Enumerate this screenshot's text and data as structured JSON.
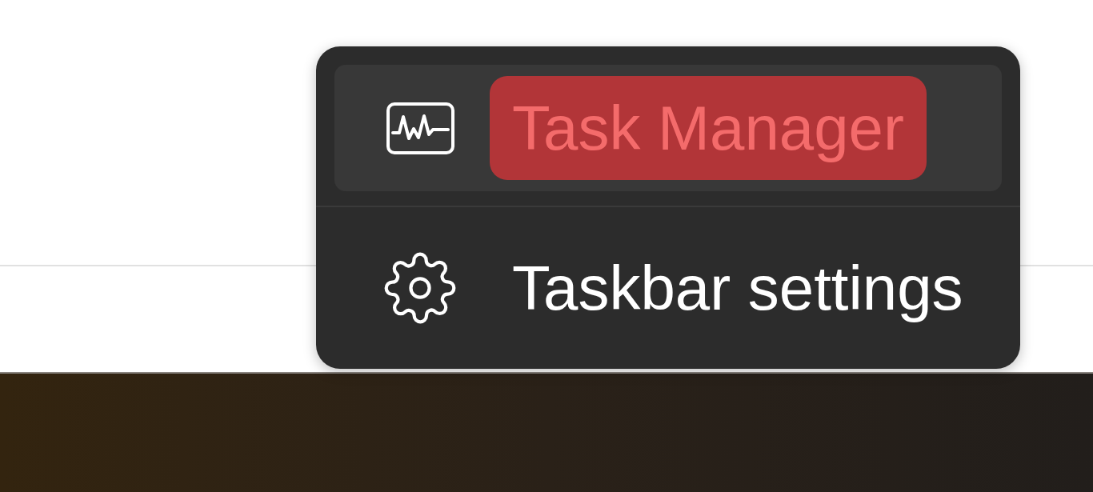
{
  "context_menu": {
    "items": [
      {
        "kind": "task-manager",
        "label": "Task Manager",
        "hovered": true,
        "highlighted": true
      },
      {
        "kind": "settings",
        "label": "Taskbar settings",
        "hovered": false,
        "highlighted": false
      }
    ]
  }
}
